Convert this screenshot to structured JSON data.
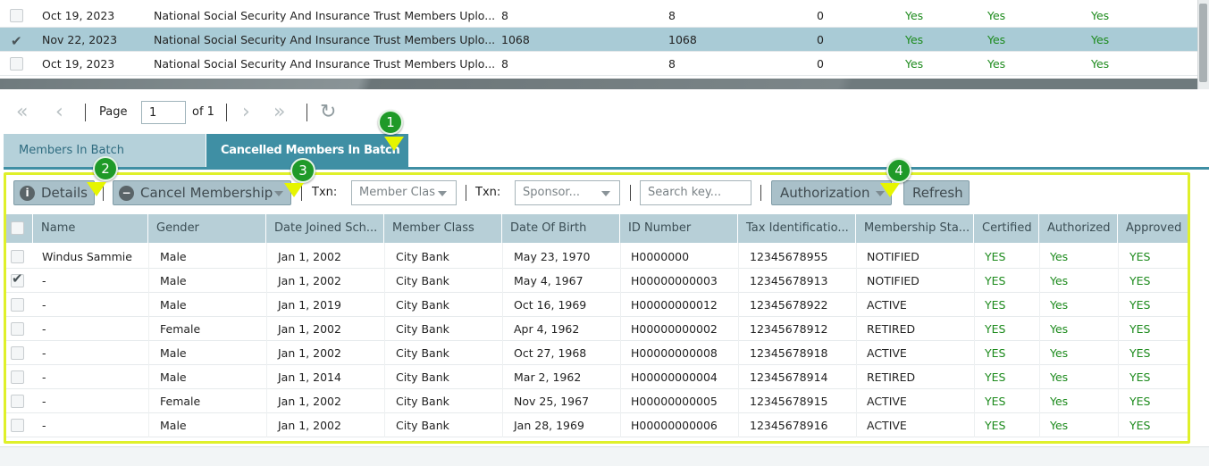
{
  "batch_grid": {
    "rows": [
      {
        "checked": false,
        "date": "Oct 19, 2023",
        "desc": "National Social Security And Insurance Trust Members Uplo...",
        "c1": "8",
        "c2": "8",
        "c3": "0",
        "y1": "Yes",
        "y2": "Yes",
        "y3": "Yes"
      },
      {
        "checked": true,
        "date": "Nov 22, 2023",
        "desc": "National Social Security And Insurance Trust Members Uplo...",
        "c1": "1068",
        "c2": "1068",
        "c3": "0",
        "y1": "Yes",
        "y2": "Yes",
        "y3": "Yes"
      },
      {
        "checked": false,
        "date": "Oct 19, 2023",
        "desc": "National Social Security And Insurance Trust Members Uplo...",
        "c1": "8",
        "c2": "8",
        "c3": "0",
        "y1": "Yes",
        "y2": "Yes",
        "y3": "Yes"
      }
    ]
  },
  "pager": {
    "first": "«",
    "prev": "‹",
    "page_label": "Page",
    "page_value": "1",
    "of_label": "of 1",
    "next": "›",
    "last": "»",
    "refresh": "↻"
  },
  "tabs": [
    {
      "label": "Members In Batch",
      "active": false
    },
    {
      "label": "Cancelled Members In Batch",
      "active": true
    }
  ],
  "markers": [
    "1",
    "2",
    "3",
    "4"
  ],
  "toolbar": {
    "details_label": "Details",
    "details_icon": "info-icon",
    "cancel_label": "Cancel Membership",
    "cancel_icon": "minus-circle-icon",
    "txn_label_1": "Txn:",
    "member_class_placeholder": "Member Clas",
    "txn_label_2": "Txn:",
    "sponsor_placeholder": "Sponsor...",
    "search_placeholder": "Search key...",
    "authorization_label": "Authorization",
    "refresh_label": "Refresh"
  },
  "members_grid": {
    "columns": [
      "Name",
      "Gender",
      "Date Joined Sch...",
      "Member Class",
      "Date Of Birth",
      "ID Number",
      "Tax Identificatio...",
      "Membership Sta...",
      "Certified",
      "Authorized",
      "Approved"
    ],
    "rows": [
      {
        "checked": false,
        "name": "Windus Sammie",
        "gender": "Male",
        "joined": "Jan 1, 2002",
        "class": "City Bank",
        "dob": "May 23, 1970",
        "id": "H0000000",
        "tin": "12345678955",
        "status": "NOTIFIED",
        "certified": "YES",
        "authorized": "Yes",
        "approved": "YES"
      },
      {
        "checked": true,
        "name": "-",
        "gender": "Male",
        "joined": "Jan 1, 2002",
        "class": "City Bank",
        "dob": "May 4, 1967",
        "id": "H00000000003",
        "tin": "12345678913",
        "status": "NOTIFIED",
        "certified": "YES",
        "authorized": "Yes",
        "approved": "YES"
      },
      {
        "checked": false,
        "name": "-",
        "gender": "Male",
        "joined": "Jan 1, 2019",
        "class": "City Bank",
        "dob": "Oct 16, 1969",
        "id": "H00000000012",
        "tin": "12345678922",
        "status": "ACTIVE",
        "certified": "YES",
        "authorized": "Yes",
        "approved": "YES"
      },
      {
        "checked": false,
        "name": "-",
        "gender": "Female",
        "joined": "Jan 1, 2002",
        "class": "City Bank",
        "dob": "Apr 4, 1962",
        "id": "H00000000002",
        "tin": "12345678912",
        "status": "RETIRED",
        "certified": "YES",
        "authorized": "Yes",
        "approved": "YES"
      },
      {
        "checked": false,
        "name": "-",
        "gender": "Male",
        "joined": "Jan 1, 2002",
        "class": "City Bank",
        "dob": "Oct 27, 1968",
        "id": "H00000000008",
        "tin": "12345678918",
        "status": "ACTIVE",
        "certified": "YES",
        "authorized": "Yes",
        "approved": "YES"
      },
      {
        "checked": false,
        "name": "-",
        "gender": "Male",
        "joined": "Jan 1, 2014",
        "class": "City Bank",
        "dob": "Mar 2, 1962",
        "id": "H00000000004",
        "tin": "12345678914",
        "status": "RETIRED",
        "certified": "YES",
        "authorized": "Yes",
        "approved": "YES"
      },
      {
        "checked": false,
        "name": "-",
        "gender": "Female",
        "joined": "Jan 1, 2002",
        "class": "City Bank",
        "dob": "Nov 25, 1967",
        "id": "H00000000005",
        "tin": "12345678915",
        "status": "ACTIVE",
        "certified": "YES",
        "authorized": "Yes",
        "approved": "YES"
      },
      {
        "checked": false,
        "name": "-",
        "gender": "Male",
        "joined": "Jan 1, 2002",
        "class": "City Bank",
        "dob": "Jan 28, 1969",
        "id": "H00000000006",
        "tin": "12345678916",
        "status": "ACTIVE",
        "certified": "YES",
        "authorized": "Yes",
        "approved": "YES"
      }
    ]
  },
  "colors": {
    "accent": "#3f8fa4",
    "yes_green": "#1c8a1c",
    "highlight": "#dff02a",
    "marker_green": "#1f9a28"
  }
}
